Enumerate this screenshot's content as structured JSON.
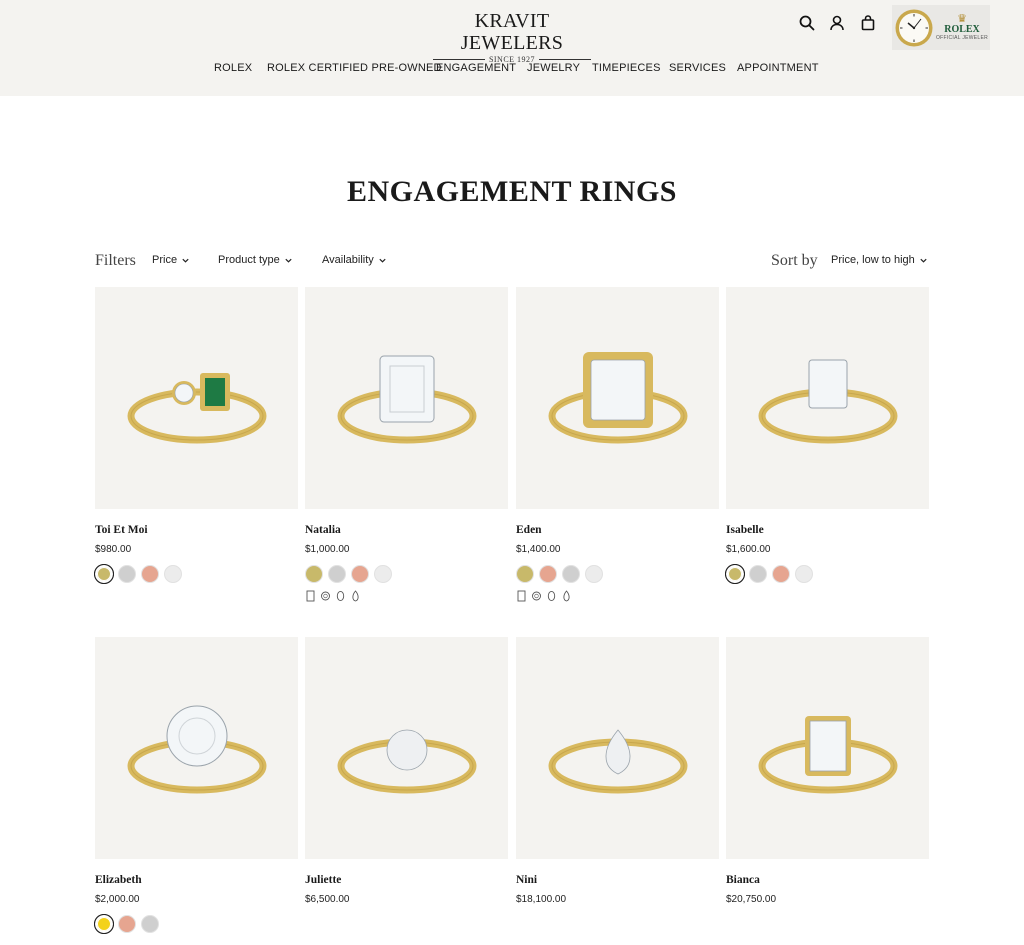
{
  "header": {
    "logo_name": "KRAVIT JEWELERS",
    "logo_since": "SINCE 1927",
    "rolex_badge": {
      "brand": "ROLEX",
      "subtitle": "OFFICIAL JEWELER"
    },
    "icons": [
      "search-icon",
      "account-icon",
      "cart-icon"
    ]
  },
  "nav": {
    "items": [
      "ROLEX",
      "ROLEX CERTIFIED PRE-OWNED",
      "ENGAGEMENT",
      "JEWELRY",
      "TIMEPIECES",
      "SERVICES",
      "APPOINTMENT"
    ]
  },
  "page": {
    "title": "ENGAGEMENT RINGS"
  },
  "filters": {
    "label": "Filters",
    "items": [
      "Price",
      "Product type",
      "Availability"
    ]
  },
  "sort": {
    "label": "Sort by",
    "value": "Price, low to high"
  },
  "colors": {
    "yellow_gold": "#c8b96a",
    "white_gold": "#cfcfcf",
    "rose_gold": "#e6a590",
    "platinum": "#ececec",
    "bright_yellow": "#f3d21a",
    "header_bg": "#f4f3f0",
    "card_bg": "#f4f3f0"
  },
  "products": [
    {
      "name": "Toi Et Moi",
      "price": "$980.00",
      "swatches": [
        "#c8b96a",
        "#cfcfcf",
        "#e6a590",
        "#ececec"
      ],
      "selected": 0,
      "shapes": []
    },
    {
      "name": "Natalia",
      "price": "$1,000.00",
      "swatches": [
        "#c8b96a",
        "#cfcfcf",
        "#e6a590",
        "#ececec"
      ],
      "selected": -1,
      "shapes": [
        "emerald",
        "round",
        "oval",
        "pear"
      ]
    },
    {
      "name": "Eden",
      "price": "$1,400.00",
      "swatches": [
        "#c8b96a",
        "#e6a590",
        "#cfcfcf",
        "#ececec"
      ],
      "selected": -1,
      "shapes": [
        "emerald",
        "round",
        "oval",
        "pear"
      ]
    },
    {
      "name": "Isabelle",
      "price": "$1,600.00",
      "swatches": [
        "#c8b96a",
        "#cfcfcf",
        "#e6a590",
        "#ececec"
      ],
      "selected": 0,
      "shapes": []
    },
    {
      "name": "Elizabeth",
      "price": "$2,000.00",
      "swatches": [
        "#f3d21a",
        "#e6a590",
        "#cfcfcf"
      ],
      "selected": 0,
      "shapes": []
    },
    {
      "name": "Juliette",
      "price": "$6,500.00",
      "swatches": [],
      "selected": -1,
      "shapes": []
    },
    {
      "name": "Nini",
      "price": "$18,100.00",
      "swatches": [],
      "selected": -1,
      "shapes": []
    },
    {
      "name": "Bianca",
      "price": "$20,750.00",
      "swatches": [],
      "selected": -1,
      "shapes": []
    }
  ]
}
